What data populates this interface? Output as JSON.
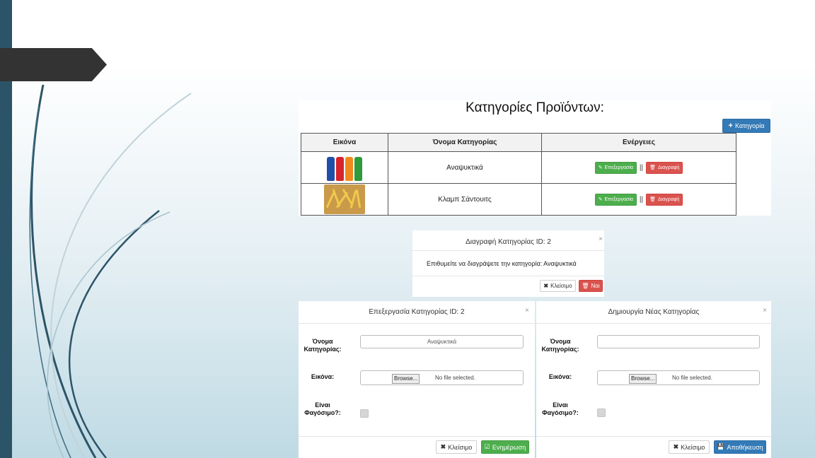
{
  "main": {
    "title": "Κατηγορίες Προϊόντων:",
    "add_button_label": "Κατηγορία",
    "columns": [
      "Εικόνα",
      "Όνομα Κατηγορίας",
      "Ενέργειες"
    ],
    "rows": [
      {
        "name": "Αναψυκτικά",
        "edit_label": "Επεξεργασία",
        "delete_label": "Διαγραφή",
        "separator": "||"
      },
      {
        "name": "Κλαμπ Σάντουιτς",
        "edit_label": "Επεξεργασία",
        "delete_label": "Διαγραφή",
        "separator": "||"
      }
    ]
  },
  "delete_modal": {
    "title": "Διαγραφή Κατηγορίας ID: 2",
    "close_symbol": "×",
    "body": "Επιθυμείτε να διαγράψετε την κατηγορία: Αναψυκτικά",
    "close_label": "Κλείσιμο",
    "confirm_label": "Ναι"
  },
  "edit_modal": {
    "title": "Επεξεργασία Κατηγορίας ID: 2",
    "close_symbol": "×",
    "name_label_1": "Όνομα",
    "name_label_2": "Κατηγορίας:",
    "name_value": "Αναψυκτικά",
    "image_label": "Εικόνα:",
    "browse_label": "Browse...",
    "no_file": "No file selected.",
    "food_label_1": "Είναι",
    "food_label_2": "Φαγόσιμο?:",
    "close_label": "Κλείσιμο",
    "submit_label": "Ενημέρωση"
  },
  "new_modal": {
    "title": "Δημιουργία Νέας Κατηγορίας",
    "close_symbol": "×",
    "name_label_1": "Όνομα",
    "name_label_2": "Κατηγορίας:",
    "name_value": "",
    "image_label": "Εικόνα:",
    "browse_label": "Browse...",
    "no_file": "No file selected.",
    "food_label_1": "Είναι",
    "food_label_2": "Φαγόσιμο?:",
    "close_label": "Κλείσιμο",
    "submit_label": "Αποθήκευση"
  },
  "colors": {
    "primary": "#337ab7",
    "success": "#4cae4c",
    "danger": "#d9534f",
    "sidebar": "#2c5468",
    "tab": "#333333"
  },
  "icons": [
    "plus-icon",
    "pencil-icon",
    "trash-icon",
    "close-x-icon",
    "check-square-icon",
    "floppy-icon"
  ]
}
